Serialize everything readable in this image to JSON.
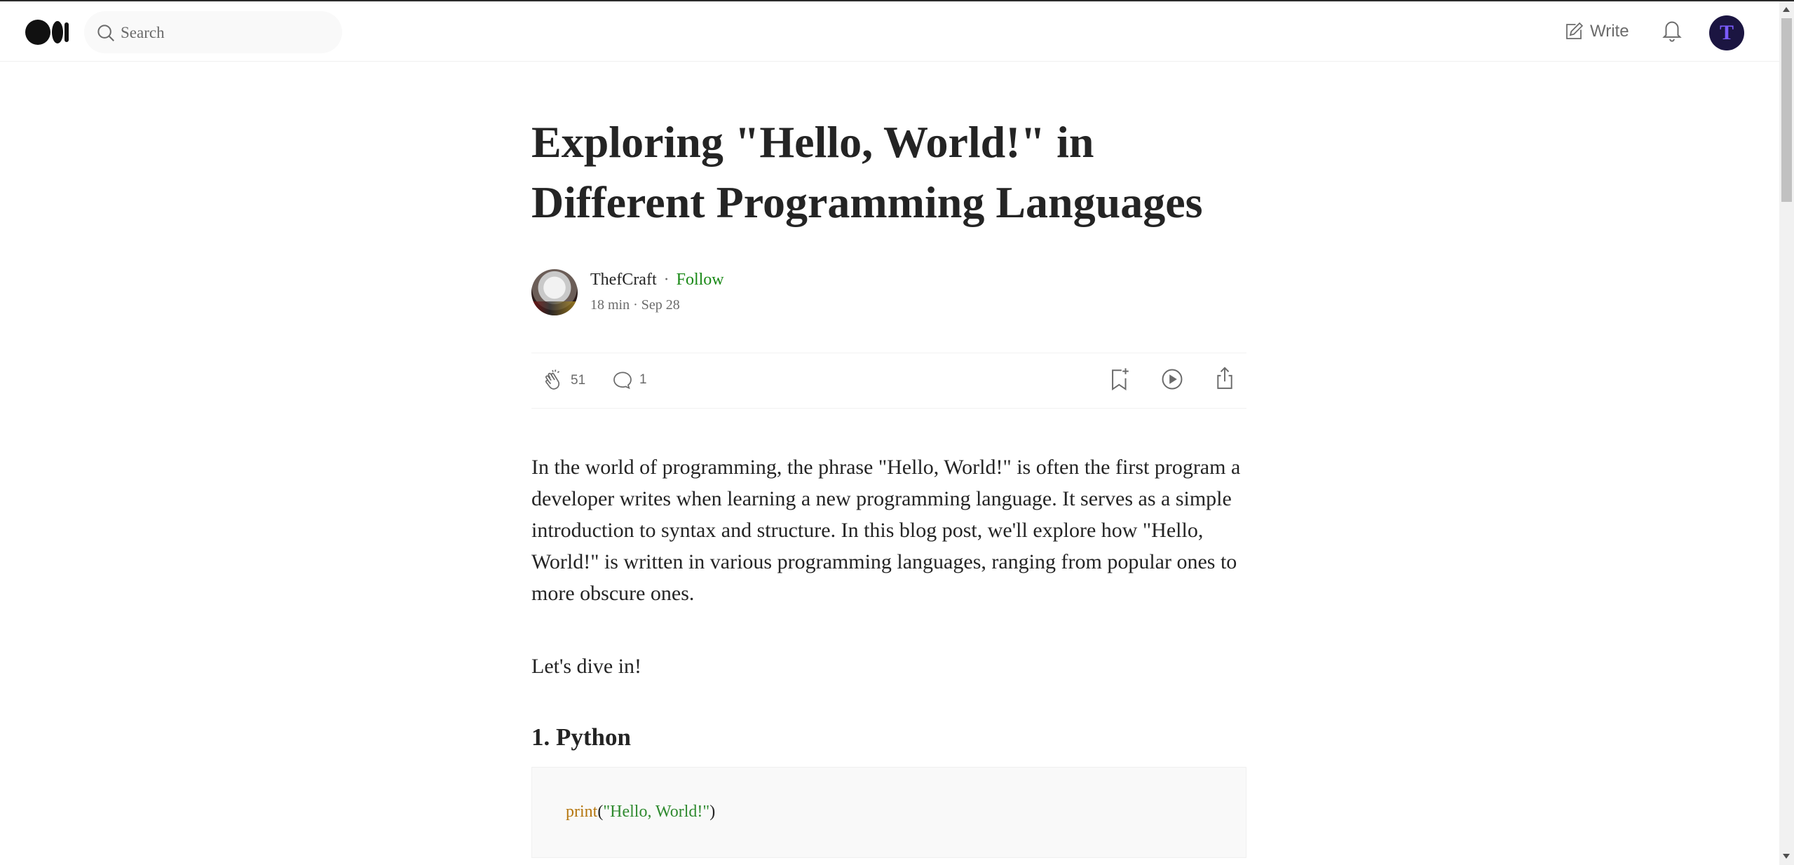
{
  "header": {
    "search_placeholder": "Search",
    "write_label": "Write",
    "avatar_letter": "T",
    "icons": {
      "logo": "medium-logo",
      "search": "search-icon",
      "write": "write-icon",
      "bell": "bell-icon"
    }
  },
  "article": {
    "title": "Exploring \"Hello, World!\" in Different Programming Languages",
    "author": "ThefCraft",
    "separator": "·",
    "follow_label": "Follow",
    "read_time": "18 min",
    "date": "Sep 28",
    "claps": "51",
    "comments": "1",
    "intro": "In the world of programming, the phrase \"Hello, World!\" is often the first program a developer writes when learning a new programming language. It serves as a simple introduction to syntax and structure. In this blog post, we'll explore how \"Hello, World!\" is written in various programming languages, ranging from popular ones to more obscure ones.",
    "dive": "Let's dive in!",
    "section_heading": "1. Python",
    "code": {
      "fn": "print",
      "open": "(",
      "str": "\"Hello, World!\"",
      "close": ")"
    }
  },
  "colors": {
    "accent_green": "#1a8917",
    "text": "#242424",
    "muted": "#6b6b6b",
    "code_fn": "#b5760e",
    "code_str": "#2f8a2f"
  }
}
